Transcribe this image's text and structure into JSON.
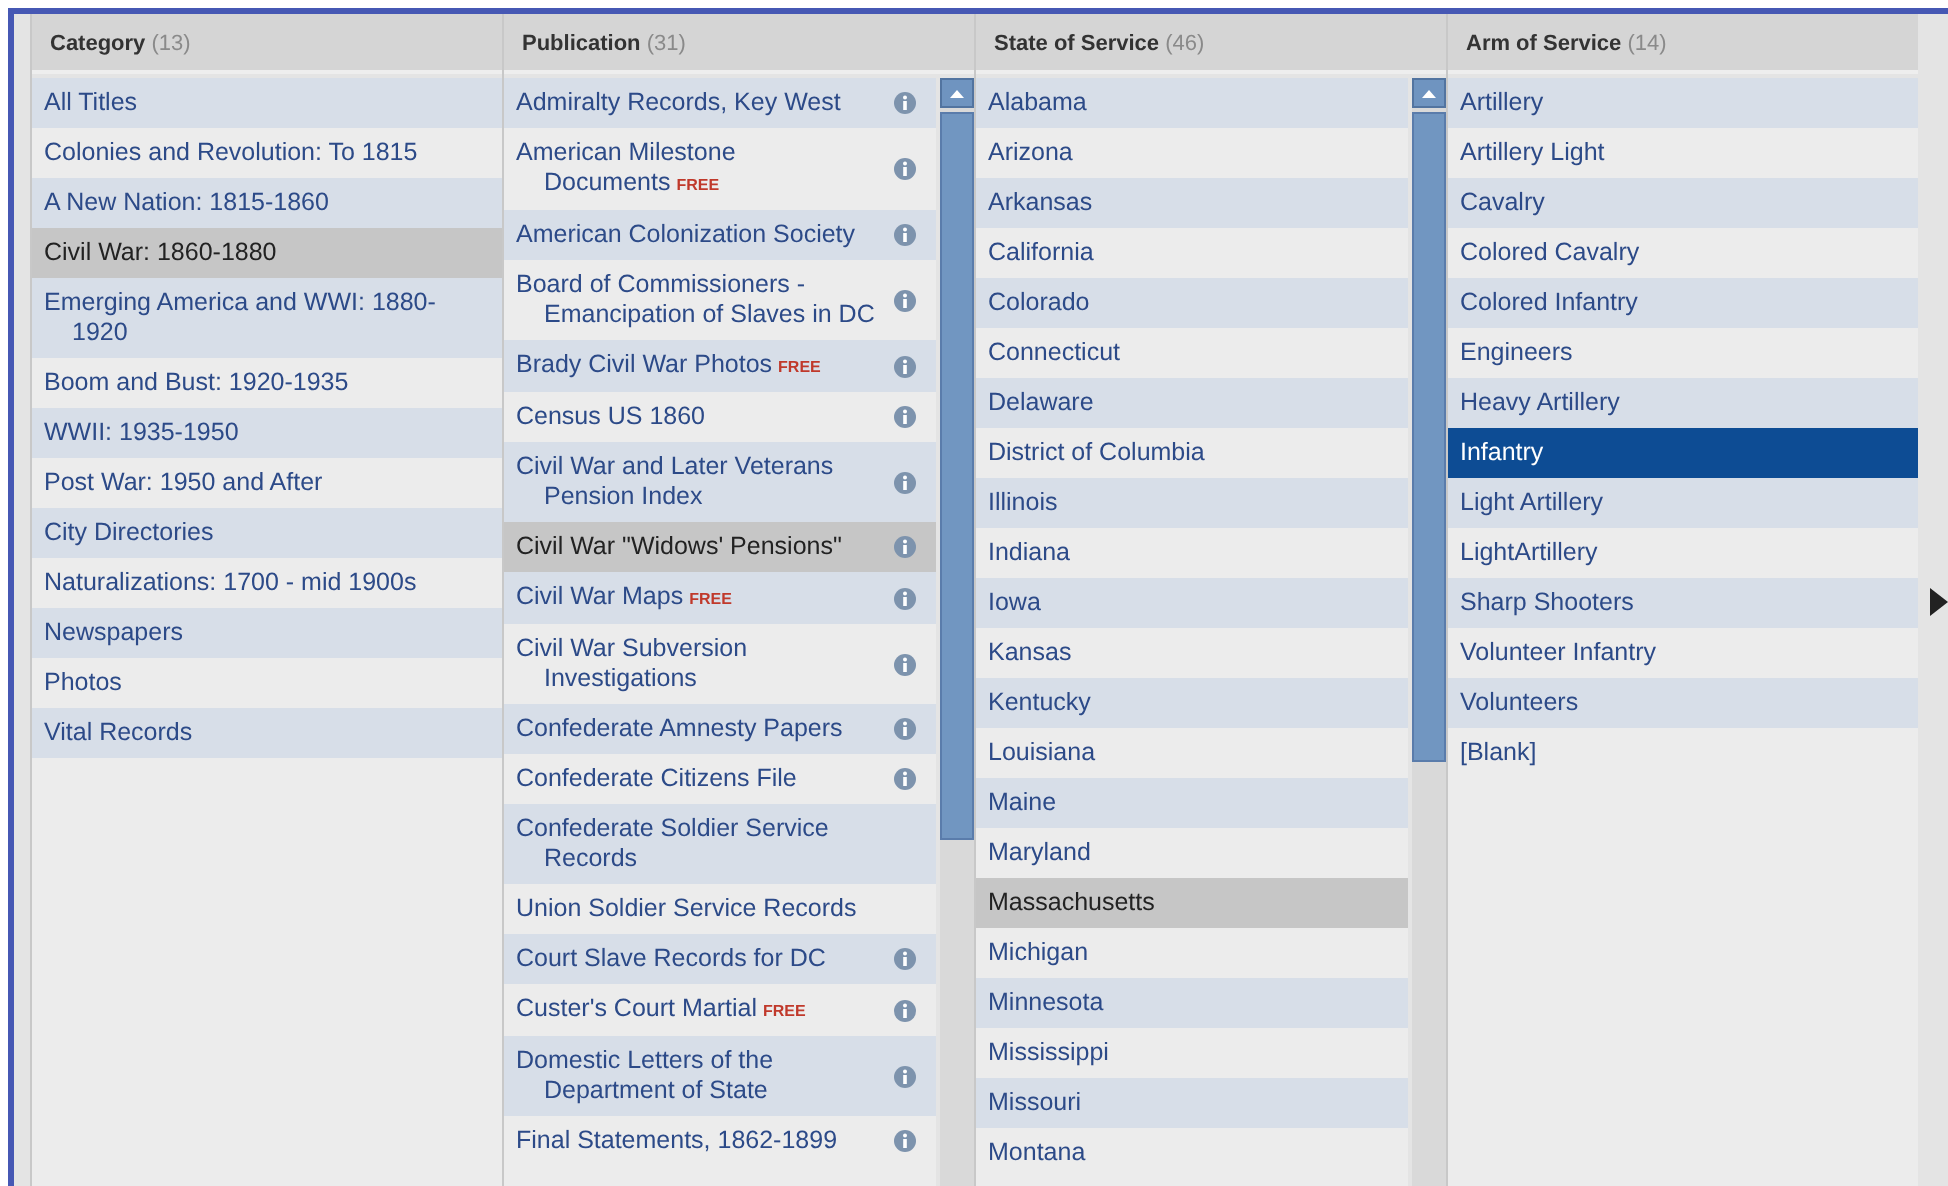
{
  "columns": [
    {
      "title": "Category",
      "count": "(13)",
      "active": false,
      "scrollbar": false,
      "items": [
        {
          "label": "All Titles",
          "selected": false
        },
        {
          "label": "Colonies and Revolution: To 1815",
          "selected": false
        },
        {
          "label": "A New Nation: 1815-1860",
          "selected": false
        },
        {
          "label": "Civil War: 1860-1880",
          "selected": true
        },
        {
          "label": "Emerging America and WWI: 1880-1920",
          "selected": false
        },
        {
          "label": "Boom and Bust: 1920-1935",
          "selected": false
        },
        {
          "label": "WWII: 1935-1950",
          "selected": false
        },
        {
          "label": "Post War: 1950 and After",
          "selected": false
        },
        {
          "label": "City Directories",
          "selected": false
        },
        {
          "label": "Naturalizations: 1700 - mid 1900s",
          "selected": false
        },
        {
          "label": "Newspapers",
          "selected": false
        },
        {
          "label": "Photos",
          "selected": false
        },
        {
          "label": "Vital Records",
          "selected": false
        }
      ]
    },
    {
      "title": "Publication",
      "count": "(31)",
      "active": false,
      "scrollbar": true,
      "items": [
        {
          "label": "Admiralty Records, Key West",
          "selected": false,
          "info": true
        },
        {
          "label": "American Milestone Documents",
          "free_tag": "FREE",
          "selected": false,
          "info": true
        },
        {
          "label": "American Colonization Society",
          "selected": false,
          "info": true
        },
        {
          "label": "Board of Commissioners - Emancipation of Slaves in DC",
          "selected": false,
          "info": true
        },
        {
          "label": "Brady Civil War Photos",
          "free_tag": "FREE",
          "selected": false,
          "info": true
        },
        {
          "label": "Census US 1860",
          "selected": false,
          "info": true
        },
        {
          "label": "Civil War and Later Veterans Pension Index",
          "selected": false,
          "info": true
        },
        {
          "label": "Civil War \"Widows' Pensions\"",
          "selected": true,
          "info": true
        },
        {
          "label": "Civil War Maps",
          "free_tag": "FREE",
          "selected": false,
          "info": true
        },
        {
          "label": "Civil War Subversion Investigations",
          "selected": false,
          "info": true
        },
        {
          "label": "Confederate Amnesty Papers",
          "selected": false,
          "info": true
        },
        {
          "label": "Confederate Citizens File",
          "selected": false,
          "info": true
        },
        {
          "label": "Confederate Soldier Service Records",
          "selected": false,
          "info": false
        },
        {
          "label": "Union Soldier Service Records",
          "selected": false,
          "info": false
        },
        {
          "label": "Court Slave Records for DC",
          "selected": false,
          "info": true
        },
        {
          "label": "Custer's Court Martial",
          "free_tag": "FREE",
          "selected": false,
          "info": true
        },
        {
          "label": "Domestic Letters of the Department of State",
          "selected": false,
          "info": true
        },
        {
          "label": "Final Statements, 1862-1899",
          "selected": false,
          "info": true
        }
      ]
    },
    {
      "title": "State of Service",
      "count": "(46)",
      "active": false,
      "scrollbar": true,
      "items": [
        {
          "label": "Alabama",
          "selected": false
        },
        {
          "label": "Arizona",
          "selected": false
        },
        {
          "label": "Arkansas",
          "selected": false
        },
        {
          "label": "California",
          "selected": false
        },
        {
          "label": "Colorado",
          "selected": false
        },
        {
          "label": "Connecticut",
          "selected": false
        },
        {
          "label": "Delaware",
          "selected": false
        },
        {
          "label": "District of Columbia",
          "selected": false
        },
        {
          "label": "Illinois",
          "selected": false
        },
        {
          "label": "Indiana",
          "selected": false
        },
        {
          "label": "Iowa",
          "selected": false
        },
        {
          "label": "Kansas",
          "selected": false
        },
        {
          "label": "Kentucky",
          "selected": false
        },
        {
          "label": "Louisiana",
          "selected": false
        },
        {
          "label": "Maine",
          "selected": false
        },
        {
          "label": "Maryland",
          "selected": false
        },
        {
          "label": "Massachusetts",
          "selected": true
        },
        {
          "label": "Michigan",
          "selected": false
        },
        {
          "label": "Minnesota",
          "selected": false
        },
        {
          "label": "Mississippi",
          "selected": false
        },
        {
          "label": "Missouri",
          "selected": false
        },
        {
          "label": "Montana",
          "selected": false
        }
      ]
    },
    {
      "title": "Arm of Service",
      "count": "(14)",
      "active": true,
      "scrollbar": false,
      "items": [
        {
          "label": "Artillery",
          "selected": false
        },
        {
          "label": "Artillery Light",
          "selected": false
        },
        {
          "label": "Cavalry",
          "selected": false
        },
        {
          "label": "Colored Cavalry",
          "selected": false
        },
        {
          "label": "Colored Infantry",
          "selected": false
        },
        {
          "label": "Engineers",
          "selected": false
        },
        {
          "label": "Heavy Artillery",
          "selected": false
        },
        {
          "label": "Infantry",
          "selected": true
        },
        {
          "label": "Light Artillery",
          "selected": false
        },
        {
          "label": "LightArtillery",
          "selected": false
        },
        {
          "label": "Sharp Shooters",
          "selected": false
        },
        {
          "label": "Volunteer Infantry",
          "selected": false
        },
        {
          "label": "Volunteers",
          "selected": false
        },
        {
          "label": "[Blank]",
          "selected": false
        }
      ]
    }
  ]
}
